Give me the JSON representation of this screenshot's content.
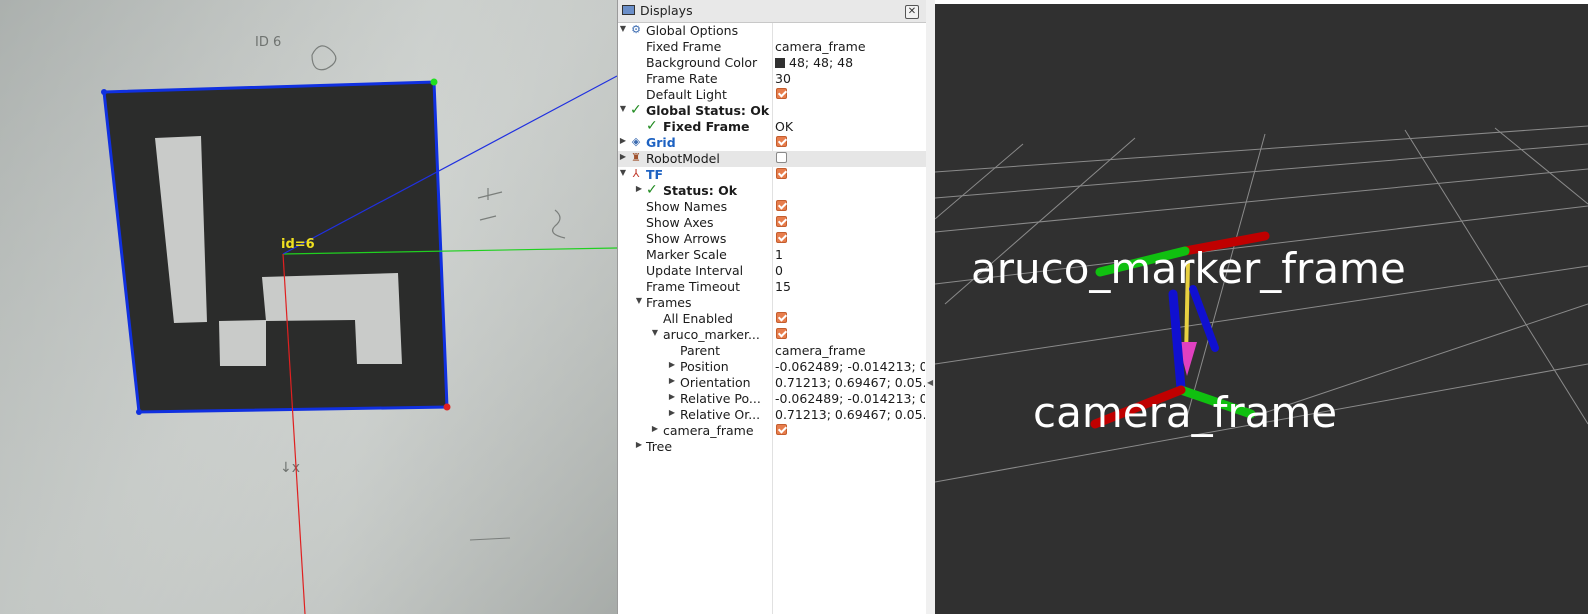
{
  "camera": {
    "marker_label": "id=6",
    "paper_annotations": [
      "ID 6",
      "↓x"
    ]
  },
  "displays": {
    "title": "Displays",
    "close_glyph": "✕",
    "rows": [
      {
        "name": "Global Options",
        "icon": "gear-icon",
        "expand": "open"
      },
      {
        "name": "Fixed Frame",
        "value": "camera_frame"
      },
      {
        "name": "Background Color",
        "value": "48; 48; 48",
        "color": "#303030"
      },
      {
        "name": "Frame Rate",
        "value": "30"
      },
      {
        "name": "Default Light",
        "checked": true
      },
      {
        "name": "Global Status: Ok",
        "status": "ok",
        "expand": "open"
      },
      {
        "name": "Fixed Frame",
        "value": "OK",
        "status": "ok"
      },
      {
        "name": "Grid",
        "icon": "grid-icon",
        "checked": true,
        "expand": "closed"
      },
      {
        "name": "RobotModel",
        "icon": "robot-icon",
        "checked": false,
        "expand": "closed",
        "selected": true
      },
      {
        "name": "TF",
        "icon": "tf-icon",
        "checked": true,
        "expand": "open"
      },
      {
        "name": "Status: Ok",
        "status": "ok",
        "expand": "closed"
      },
      {
        "name": "Show Names",
        "checked": true
      },
      {
        "name": "Show Axes",
        "checked": true
      },
      {
        "name": "Show Arrows",
        "checked": true
      },
      {
        "name": "Marker Scale",
        "value": "1"
      },
      {
        "name": "Update Interval",
        "value": "0"
      },
      {
        "name": "Frame Timeout",
        "value": "15"
      },
      {
        "name": "Frames",
        "expand": "open"
      },
      {
        "name": "All Enabled",
        "checked": true
      },
      {
        "name": "aruco_marker...",
        "checked": true,
        "expand": "open"
      },
      {
        "name": "Parent",
        "value": "camera_frame"
      },
      {
        "name": "Position",
        "value": "-0.062489; -0.014213; 0...",
        "expand": "closed"
      },
      {
        "name": "Orientation",
        "value": "0.71213; 0.69467; 0.05...",
        "expand": "closed"
      },
      {
        "name": "Relative Po...",
        "value": "-0.062489; -0.014213; 0...",
        "expand": "closed"
      },
      {
        "name": "Relative Or...",
        "value": "0.71213; 0.69467; 0.05...",
        "expand": "closed"
      },
      {
        "name": "camera_frame",
        "checked": true,
        "expand": "closed"
      },
      {
        "name": "Tree",
        "expand": "closed"
      }
    ]
  },
  "view3d": {
    "background": "#303030",
    "frames": [
      {
        "name": "aruco_marker_frame"
      },
      {
        "name": "camera_frame"
      }
    ],
    "axis_colors": {
      "x": "#cc0000",
      "y": "#00cc00",
      "z": "#0000cc"
    },
    "arrow_color": "#e8d040"
  }
}
